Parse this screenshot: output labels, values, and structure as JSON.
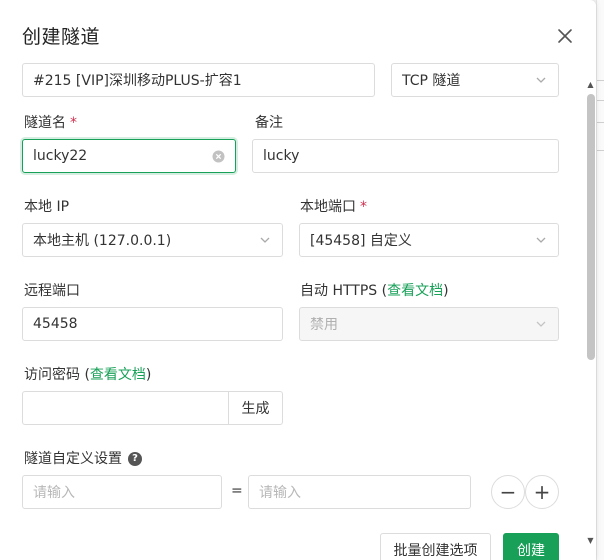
{
  "modal": {
    "title": "创建隧道"
  },
  "node_select": {
    "value": "#215 [VIP]深圳移动PLUS-扩容1"
  },
  "type_select": {
    "value": "TCP 隧道"
  },
  "tunnel_name": {
    "label": "隧道名",
    "required_mark": "*",
    "value": "lucky22"
  },
  "remark": {
    "label": "备注",
    "value": "lucky"
  },
  "local_ip": {
    "label": "本地 IP",
    "value": "本地主机 (127.0.0.1)"
  },
  "local_port": {
    "label": "本地端口",
    "required_mark": "*",
    "value": "[45458] 自定义"
  },
  "remote_port": {
    "label": "远程端口",
    "value": "45458"
  },
  "auto_https": {
    "label": "自动 HTTPS",
    "paren_open": "(",
    "doc_link": "查看文档",
    "paren_close": ")",
    "value": "禁用"
  },
  "access_password": {
    "label": "访问密码",
    "paren_open": "(",
    "doc_link": "查看文档",
    "paren_close": ")",
    "value": "",
    "generate_label": "生成"
  },
  "custom_settings": {
    "label": "隧道自定义设置",
    "help_icon": "?",
    "key_placeholder": "请输入",
    "equals": "=",
    "value_placeholder": "请输入",
    "remove_icon": "−",
    "add_icon": "+"
  },
  "footer": {
    "batch_label": "批量创建选项",
    "create_label": "创建"
  },
  "colors": {
    "accent": "#18a058",
    "required": "#d03050",
    "border": "#dcdcdc"
  }
}
